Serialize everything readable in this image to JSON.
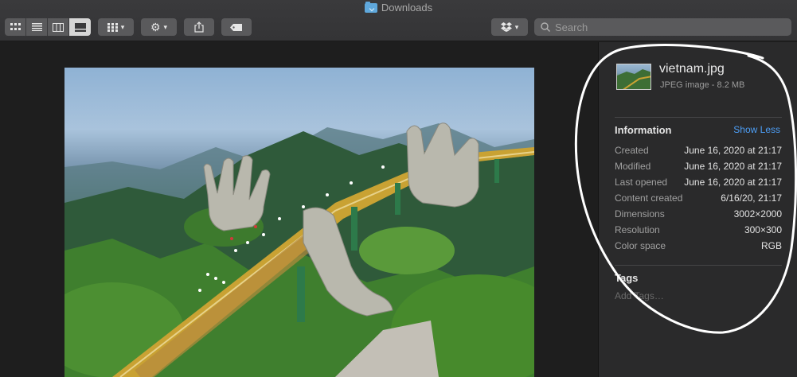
{
  "window": {
    "title": "Downloads"
  },
  "toolbar": {
    "view_modes": [
      "icon-view-icon",
      "list-view-icon",
      "column-view-icon",
      "gallery-view-icon"
    ],
    "active_view": "gallery",
    "buttons": [
      "group-icon",
      "gear-icon",
      "share-icon",
      "tag-icon",
      "dropbox-icon"
    ],
    "search_placeholder": "Search"
  },
  "file": {
    "name": "vietnam.jpg",
    "kind_size": "JPEG image - 8.2 MB"
  },
  "information": {
    "title": "Information",
    "toggle_label": "Show Less",
    "rows": [
      {
        "key": "Created",
        "value": "June 16, 2020 at 21:17"
      },
      {
        "key": "Modified",
        "value": "June 16, 2020 at 21:17"
      },
      {
        "key": "Last opened",
        "value": "June 16, 2020 at 21:17"
      },
      {
        "key": "Content created",
        "value": "6/16/20, 21:17"
      },
      {
        "key": "Dimensions",
        "value": "3002×2000"
      },
      {
        "key": "Resolution",
        "value": "300×300"
      },
      {
        "key": "Color space",
        "value": "RGB"
      }
    ]
  },
  "tags": {
    "title": "Tags",
    "placeholder": "Add Tags…"
  },
  "colors": {
    "accent": "#4d9ef5",
    "annotation": "#ffffff"
  }
}
